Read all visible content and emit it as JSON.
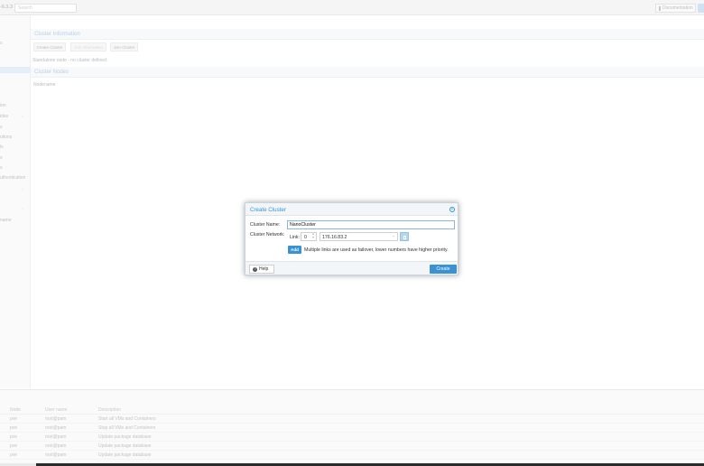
{
  "header": {
    "version_text": "-6.3.3",
    "search_placeholder": "Search",
    "documentation_label": "Documentation"
  },
  "leftnav": {
    "items": [
      "s",
      "ion",
      "ides",
      "s",
      "utions",
      "ls",
      "s",
      "s",
      "uthentication",
      "name"
    ]
  },
  "content": {
    "cluster_info_title": "Cluster Information",
    "create_cluster_label": "Create Cluster",
    "join_information_label": "Join Information",
    "join_cluster_label": "Join Cluster",
    "standalone_text": "Standalone node - no cluster defined",
    "cluster_nodes_title": "Cluster Nodes",
    "nodename_header": "Nodename"
  },
  "tasklog": {
    "columns": {
      "node": "Node",
      "user": "User name",
      "description": "Description"
    },
    "rows": [
      {
        "node": "pve",
        "user": "root@pam",
        "description": "Start all VMs and Containers"
      },
      {
        "node": "pve",
        "user": "root@pam",
        "description": "Stop all VMs and Containers"
      },
      {
        "node": "pve",
        "user": "root@pam",
        "description": "Update package database"
      },
      {
        "node": "pve",
        "user": "root@pam",
        "description": "Update package database"
      },
      {
        "node": "pve",
        "user": "root@pam",
        "description": "Update package database"
      }
    ]
  },
  "dialog": {
    "title": "Create Cluster",
    "cluster_name_label": "Cluster Name:",
    "cluster_name_value": "NanoCluster",
    "cluster_network_label": "Cluster Network:",
    "link_label": "Link:",
    "link_value": "0",
    "ip_value": "176.16.83.2",
    "add_label": "Add",
    "hint_text": "Multiple links are used as failover, lower numbers have higher priority.",
    "help_label": "Help",
    "create_label": "Create"
  },
  "colors": {
    "accent": "#3892d4",
    "modal_header_bg": "#f3f6f9"
  },
  "icons": {
    "close": "close-circle-icon",
    "trash": "trash-icon",
    "help": "question-circle-icon",
    "dropdown": "chevron-down-icon",
    "docs": "book-icon"
  }
}
